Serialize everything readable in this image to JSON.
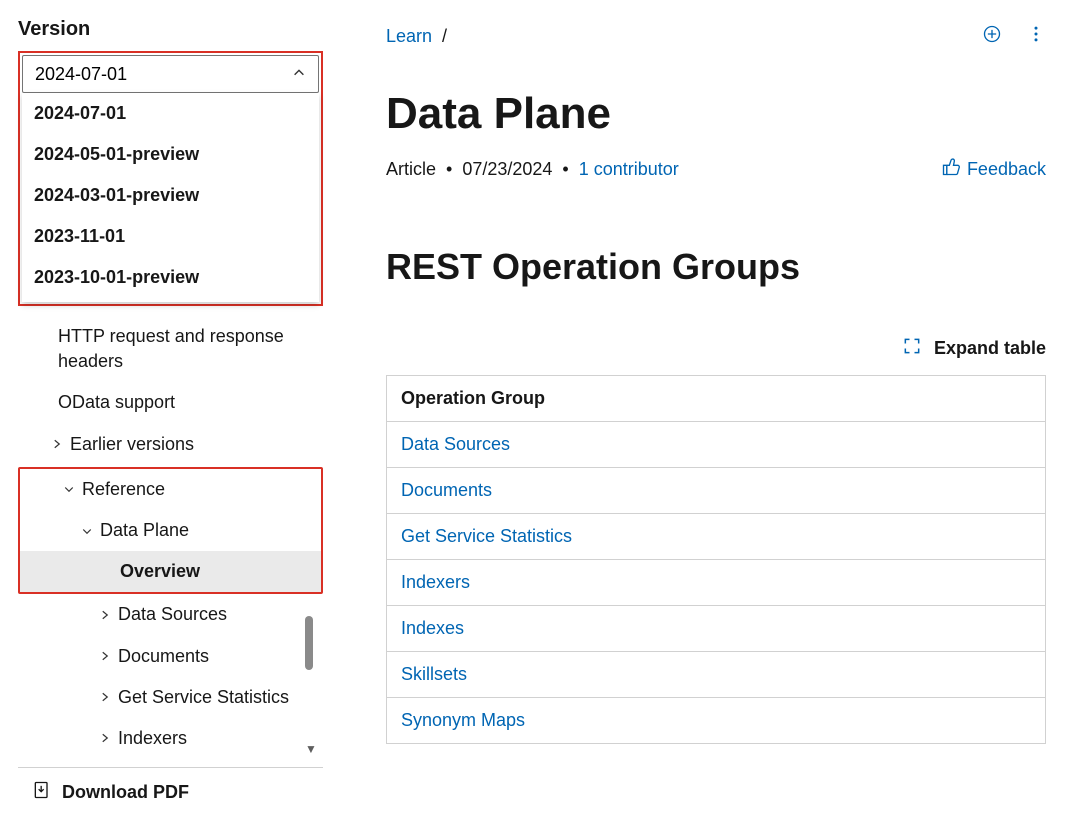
{
  "sidebar": {
    "version_label": "Version",
    "selected_version": "2024-07-01",
    "options": [
      "2024-07-01",
      "2024-05-01-preview",
      "2024-03-01-preview",
      "2023-11-01",
      "2023-10-01-preview"
    ],
    "tree": {
      "http_headers": "HTTP request and response headers",
      "odata": "OData support",
      "earlier": "Earlier versions",
      "reference": "Reference",
      "data_plane": "Data Plane",
      "overview": "Overview",
      "data_sources": "Data Sources",
      "documents": "Documents",
      "get_service_stats": "Get Service Statistics",
      "indexers": "Indexers"
    },
    "download_pdf": "Download PDF"
  },
  "breadcrumb": {
    "root": "Learn",
    "sep": "/"
  },
  "page": {
    "title": "Data Plane",
    "type": "Article",
    "date": "07/23/2024",
    "contributors": "1 contributor",
    "feedback": "Feedback",
    "section": "REST Operation Groups",
    "expand": "Expand table",
    "table_header": "Operation Group",
    "rows": [
      "Data Sources",
      "Documents",
      "Get Service Statistics",
      "Indexers",
      "Indexes",
      "Skillsets",
      "Synonym Maps"
    ]
  }
}
